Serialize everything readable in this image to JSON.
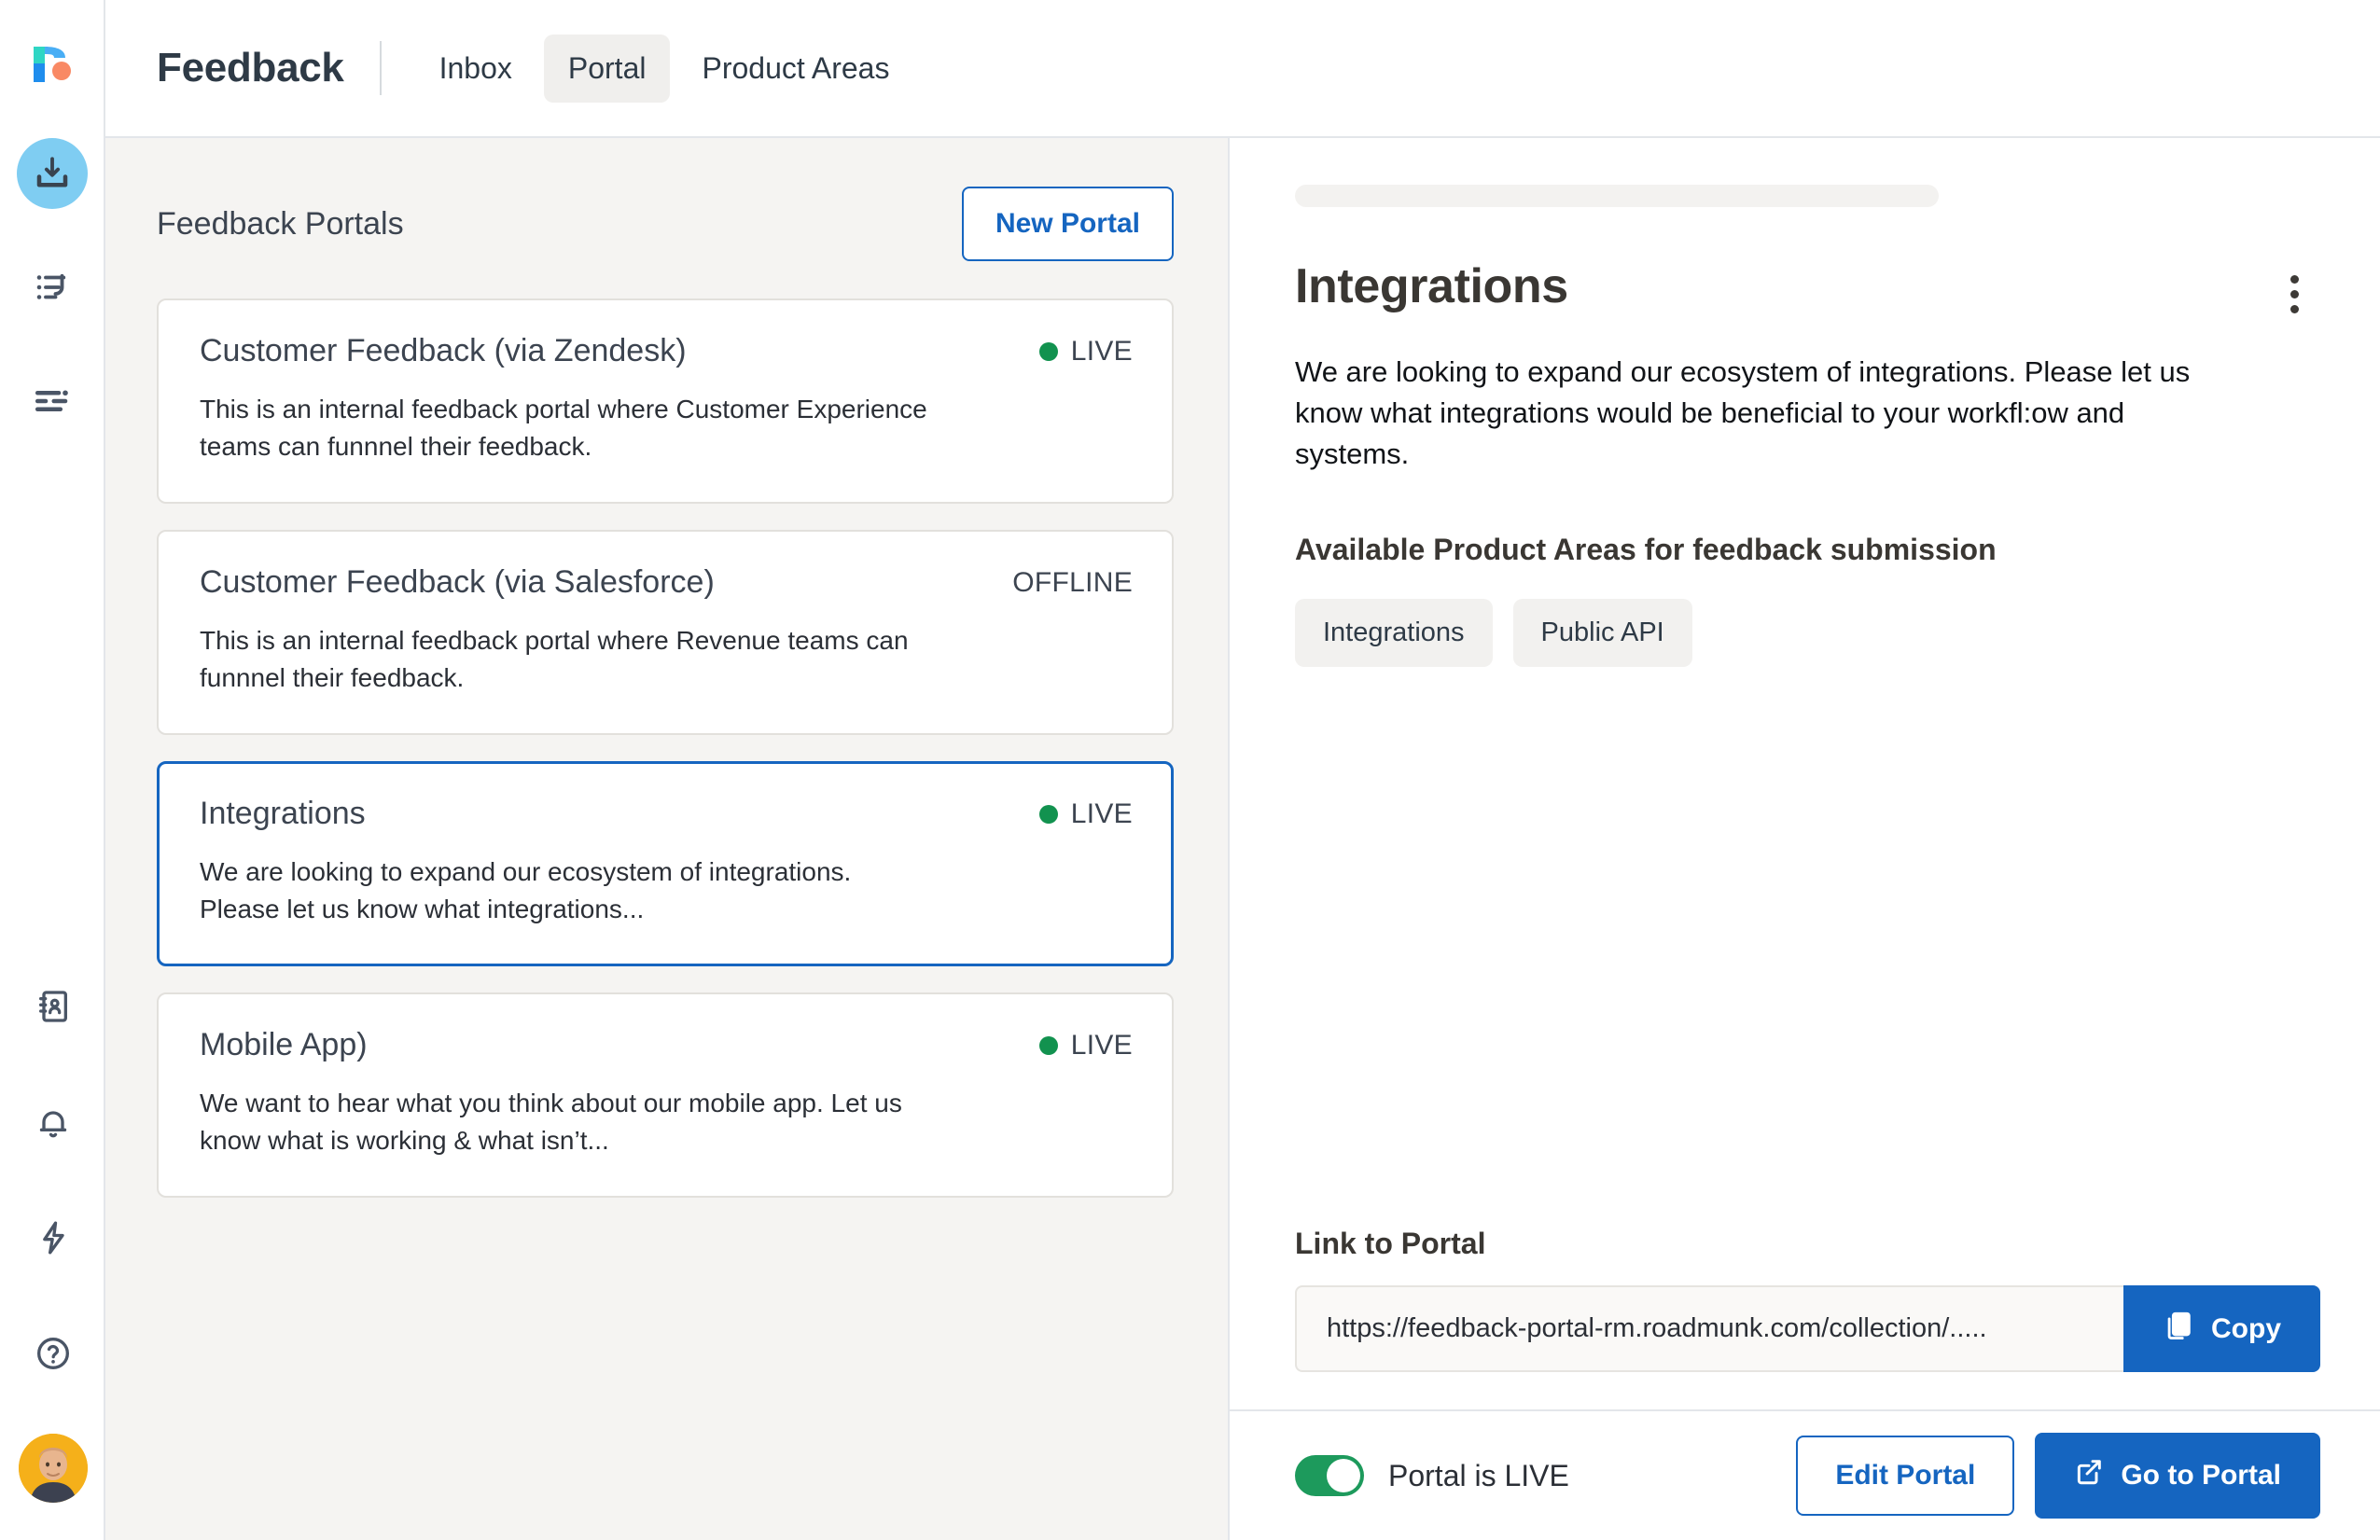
{
  "app": {
    "logo_name": "roadmunk-logo",
    "title": "Feedback"
  },
  "nav_rail": {
    "items": [
      {
        "icon": "inbox-download-icon",
        "active": true
      },
      {
        "icon": "feedback-list-icon",
        "active": false
      },
      {
        "icon": "product-areas-icon",
        "active": false
      }
    ],
    "bottom_items": [
      {
        "icon": "contacts-book-icon"
      },
      {
        "icon": "bell-icon"
      },
      {
        "icon": "lightning-bolt-icon"
      },
      {
        "icon": "help-circle-icon"
      },
      {
        "icon": "user-avatar"
      }
    ]
  },
  "tabs": [
    {
      "label": "Inbox",
      "active": false
    },
    {
      "label": "Portal",
      "active": true
    },
    {
      "label": "Product Areas",
      "active": false
    }
  ],
  "list_panel": {
    "heading": "Feedback Portals",
    "new_portal_label": "New Portal",
    "portals": [
      {
        "title": "Customer Feedback (via Zendesk)",
        "status": "LIVE",
        "live": true,
        "description": "This is an internal feedback portal where Customer Experience teams can funnnel their feedback.",
        "selected": false
      },
      {
        "title": "Customer Feedback (via Salesforce)",
        "status": "OFFLINE",
        "live": false,
        "description": "This is an internal feedback portal where Revenue teams can funnnel their feedback.",
        "selected": false
      },
      {
        "title": "Integrations",
        "status": "LIVE",
        "live": true,
        "description": "We are looking to expand our ecosystem of integrations. Please let us know what integrations...",
        "selected": true
      },
      {
        "title": "Mobile App)",
        "status": "LIVE",
        "live": true,
        "description": "We want to hear what you think about our mobile app. Let us know what is working & what isn’t...",
        "selected": false
      }
    ]
  },
  "detail": {
    "title": "Integrations",
    "kebab_icon": "more-vertical-icon",
    "description": "We are looking to expand our ecosystem of integrations. Please let us know what integrations would be beneficial to your workfl:ow and systems.",
    "product_areas_heading": "Available Product Areas for feedback submission",
    "product_areas": [
      "Integrations",
      "Public API"
    ],
    "link_label": "Link to Portal",
    "link_value": "https://feedback-portal-rm.roadmunk.com/collection/.....",
    "link_placeholder": "https://",
    "copy_label": "Copy",
    "copy_icon": "copy-icon"
  },
  "action_bar": {
    "toggle_label": "Portal is LIVE",
    "toggle_on": true,
    "edit_label": "Edit Portal",
    "goto_label": "Go to Portal",
    "goto_icon": "external-link-icon"
  },
  "colors": {
    "accent_blue": "#1565c0",
    "live_green": "#12924f",
    "toggle_green": "#1d9a5c",
    "panel_bg": "#f5f4f2",
    "logo_blue": "#1f8ded",
    "logo_teal": "#2fd6c4",
    "logo_coral": "#f98964",
    "avatar_bg": "#f5b01a",
    "rail_active_bg": "#7fcdf2"
  }
}
